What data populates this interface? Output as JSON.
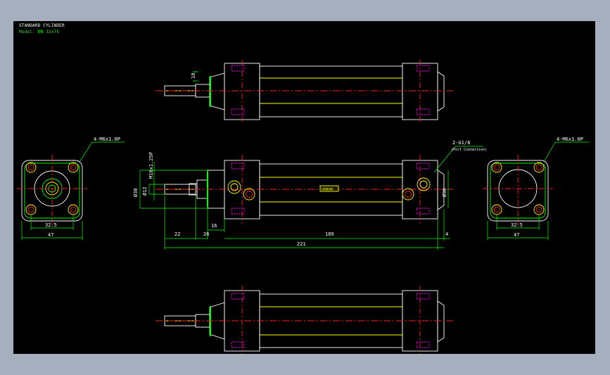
{
  "title_block": {
    "line1": "STANDARD CYLINDER",
    "line2": "Model: DN 32x75"
  },
  "colors": {
    "background": "#000000",
    "frame": "#a6afbd",
    "body": "#ffffff",
    "centerline": "#ff2020",
    "dimension": "#00ff00",
    "annotation": "#ffffff",
    "hidden": "#ff00ff",
    "highlight": "#ffff00",
    "rod": "#00c000"
  },
  "dims": {
    "rod_len": "22",
    "nose_len": "26",
    "cushion": "16",
    "stroke_body": "189",
    "end_cap": "4",
    "overall": "221",
    "bore_left": "Ø30",
    "rod_dia": "Ø12",
    "bore_right": "Ø30",
    "thread": "M10x1.25P",
    "top_ten": "10",
    "left_pitch": "32.5",
    "left_width": "47",
    "right_pitch": "32.5",
    "right_width": "47"
  },
  "callouts": {
    "left_mount": "4-M6x1.0P",
    "port": "2-G1/8",
    "port_sub": "(Port Connection)",
    "right_mount": "4-M6x1.0P",
    "label_badge": "VENDOR"
  }
}
